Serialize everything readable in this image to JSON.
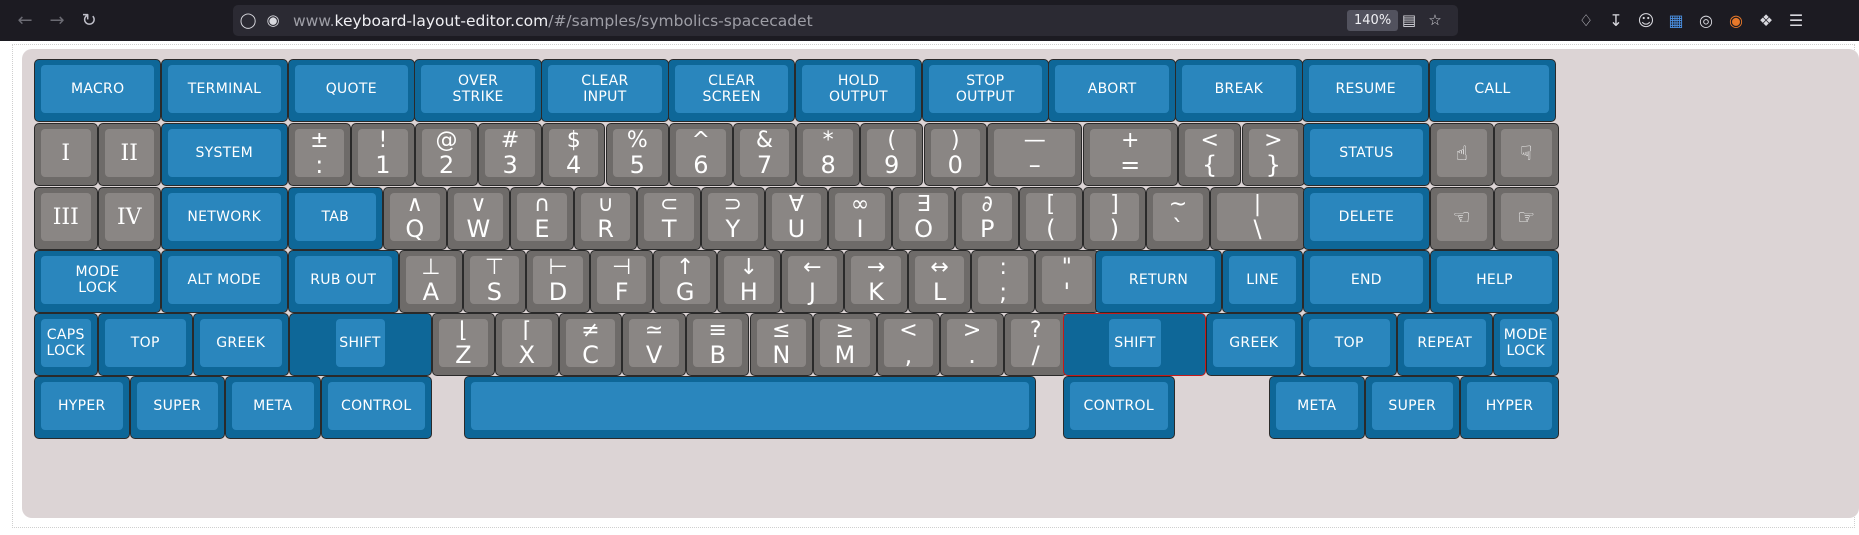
{
  "browser": {
    "back_icon": "arrow-left-icon",
    "forward_icon": "arrow-right-icon",
    "reload_icon": "reload-icon",
    "url_prefix": "www.",
    "url_domain": "keyboard-layout-editor.com",
    "url_path": "/#/samples/symbolics-spacecadet",
    "zoom": "140%",
    "icons": [
      "shield-icon",
      "lock-icon",
      "translate-icon",
      "star-icon",
      "pocket-icon",
      "download-icon",
      "account-icon",
      "translate-extension-icon",
      "globe-icon",
      "fox-extension-icon",
      "extensions-icon",
      "menu-icon"
    ]
  },
  "colors": {
    "blue_key": "#2a86bd",
    "blue_key_border": "#0e6798",
    "gray_key": "#8a8684",
    "gray_key_border": "#6e6b69",
    "plate": "#dcd4d5",
    "selected_outline": "#c41a1a"
  },
  "keyboard": {
    "row1": [
      "MACRO",
      "TERMINAL",
      "QUOTE",
      "OVER\nSTRIKE",
      "CLEAR\nINPUT",
      "CLEAR\nSCREEN",
      "HOLD\nOUTPUT",
      "STOP\nOUTPUT",
      "ABORT",
      "BREAK",
      "RESUME",
      "CALL"
    ],
    "row2": {
      "roman": [
        "I",
        "II"
      ],
      "system": "SYSTEM",
      "legends": [
        {
          "top": "±",
          "bottom": ":"
        },
        {
          "top": "!",
          "bottom": "1"
        },
        {
          "top": "@",
          "bottom": "2"
        },
        {
          "top": "#",
          "bottom": "3"
        },
        {
          "top": "$",
          "bottom": "4"
        },
        {
          "top": "%",
          "bottom": "5"
        },
        {
          "top": "^",
          "bottom": "6"
        },
        {
          "top": "&",
          "bottom": "7"
        },
        {
          "top": "*",
          "bottom": "8"
        },
        {
          "top": "(",
          "bottom": "9"
        },
        {
          "top": ")",
          "bottom": "0"
        },
        {
          "top": "—",
          "bottom": "–"
        },
        {
          "top": "+",
          "bottom": "="
        },
        {
          "top": "<",
          "bottom": "{"
        },
        {
          "top": ">",
          "bottom": "}"
        }
      ],
      "status": "STATUS",
      "icons": [
        "☝",
        "☟"
      ]
    },
    "row3": {
      "roman": [
        "III",
        "IV"
      ],
      "network": "NETWORK",
      "tab": "TAB",
      "legends": [
        {
          "top": "∧",
          "bottom": "Q"
        },
        {
          "top": "∨",
          "bottom": "W"
        },
        {
          "top": "∩",
          "bottom": "E"
        },
        {
          "top": "∪",
          "bottom": "R"
        },
        {
          "top": "⊂",
          "bottom": "T"
        },
        {
          "top": "⊃",
          "bottom": "Y"
        },
        {
          "top": "∀",
          "bottom": "U"
        },
        {
          "top": "∞",
          "bottom": "I"
        },
        {
          "top": "∃",
          "bottom": "O"
        },
        {
          "top": "∂",
          "bottom": "P"
        },
        {
          "top": "[",
          "bottom": "("
        },
        {
          "top": "]",
          "bottom": ")"
        },
        {
          "top": "~",
          "bottom": "`"
        },
        {
          "top": "|",
          "bottom": "\\"
        }
      ],
      "delete": "DELETE",
      "icons": [
        "☜",
        "☞"
      ]
    },
    "row4": {
      "mode_lock": "MODE\nLOCK",
      "alt_mode": "ALT MODE",
      "rub_out": "RUB OUT",
      "legends": [
        {
          "top": "⊥",
          "bottom": "A"
        },
        {
          "top": "⊤",
          "bottom": "S"
        },
        {
          "top": "⊢",
          "bottom": "D"
        },
        {
          "top": "⊣",
          "bottom": "F"
        },
        {
          "top": "↑",
          "bottom": "G"
        },
        {
          "top": "↓",
          "bottom": "H"
        },
        {
          "top": "←",
          "bottom": "J"
        },
        {
          "top": "→",
          "bottom": "K"
        },
        {
          "top": "↔",
          "bottom": "L"
        },
        {
          "top": ":",
          "bottom": ";"
        },
        {
          "top": "\"",
          "bottom": "'"
        }
      ],
      "return": "RETURN",
      "line": "LINE",
      "end": "END",
      "help": "HELP"
    },
    "row5": {
      "caps_lock": "CAPS\nLOCK",
      "top": "TOP",
      "greek": "GREEK",
      "shift": "SHIFT",
      "legends": [
        {
          "top": "⌊",
          "bottom": "Z"
        },
        {
          "top": "⌈",
          "bottom": "X"
        },
        {
          "top": "≠",
          "bottom": "C"
        },
        {
          "top": "≃",
          "bottom": "V"
        },
        {
          "top": "≡",
          "bottom": "B"
        },
        {
          "top": "≤",
          "bottom": "N"
        },
        {
          "top": "≥",
          "bottom": "M"
        },
        {
          "top": "<",
          "bottom": ","
        },
        {
          "top": ">",
          "bottom": "."
        },
        {
          "top": "?",
          "bottom": "/"
        }
      ],
      "shift_right": "SHIFT",
      "greek_right": "GREEK",
      "top_right": "TOP",
      "repeat": "REPEAT",
      "mode_lock_right": "MODE\nLOCK"
    },
    "row6": {
      "hyper": "HYPER",
      "super": "SUPER",
      "meta": "META",
      "control": "CONTROL",
      "space": "",
      "control_right": "CONTROL",
      "meta_right": "META",
      "super_right": "SUPER",
      "hyper_right": "HYPER"
    }
  }
}
